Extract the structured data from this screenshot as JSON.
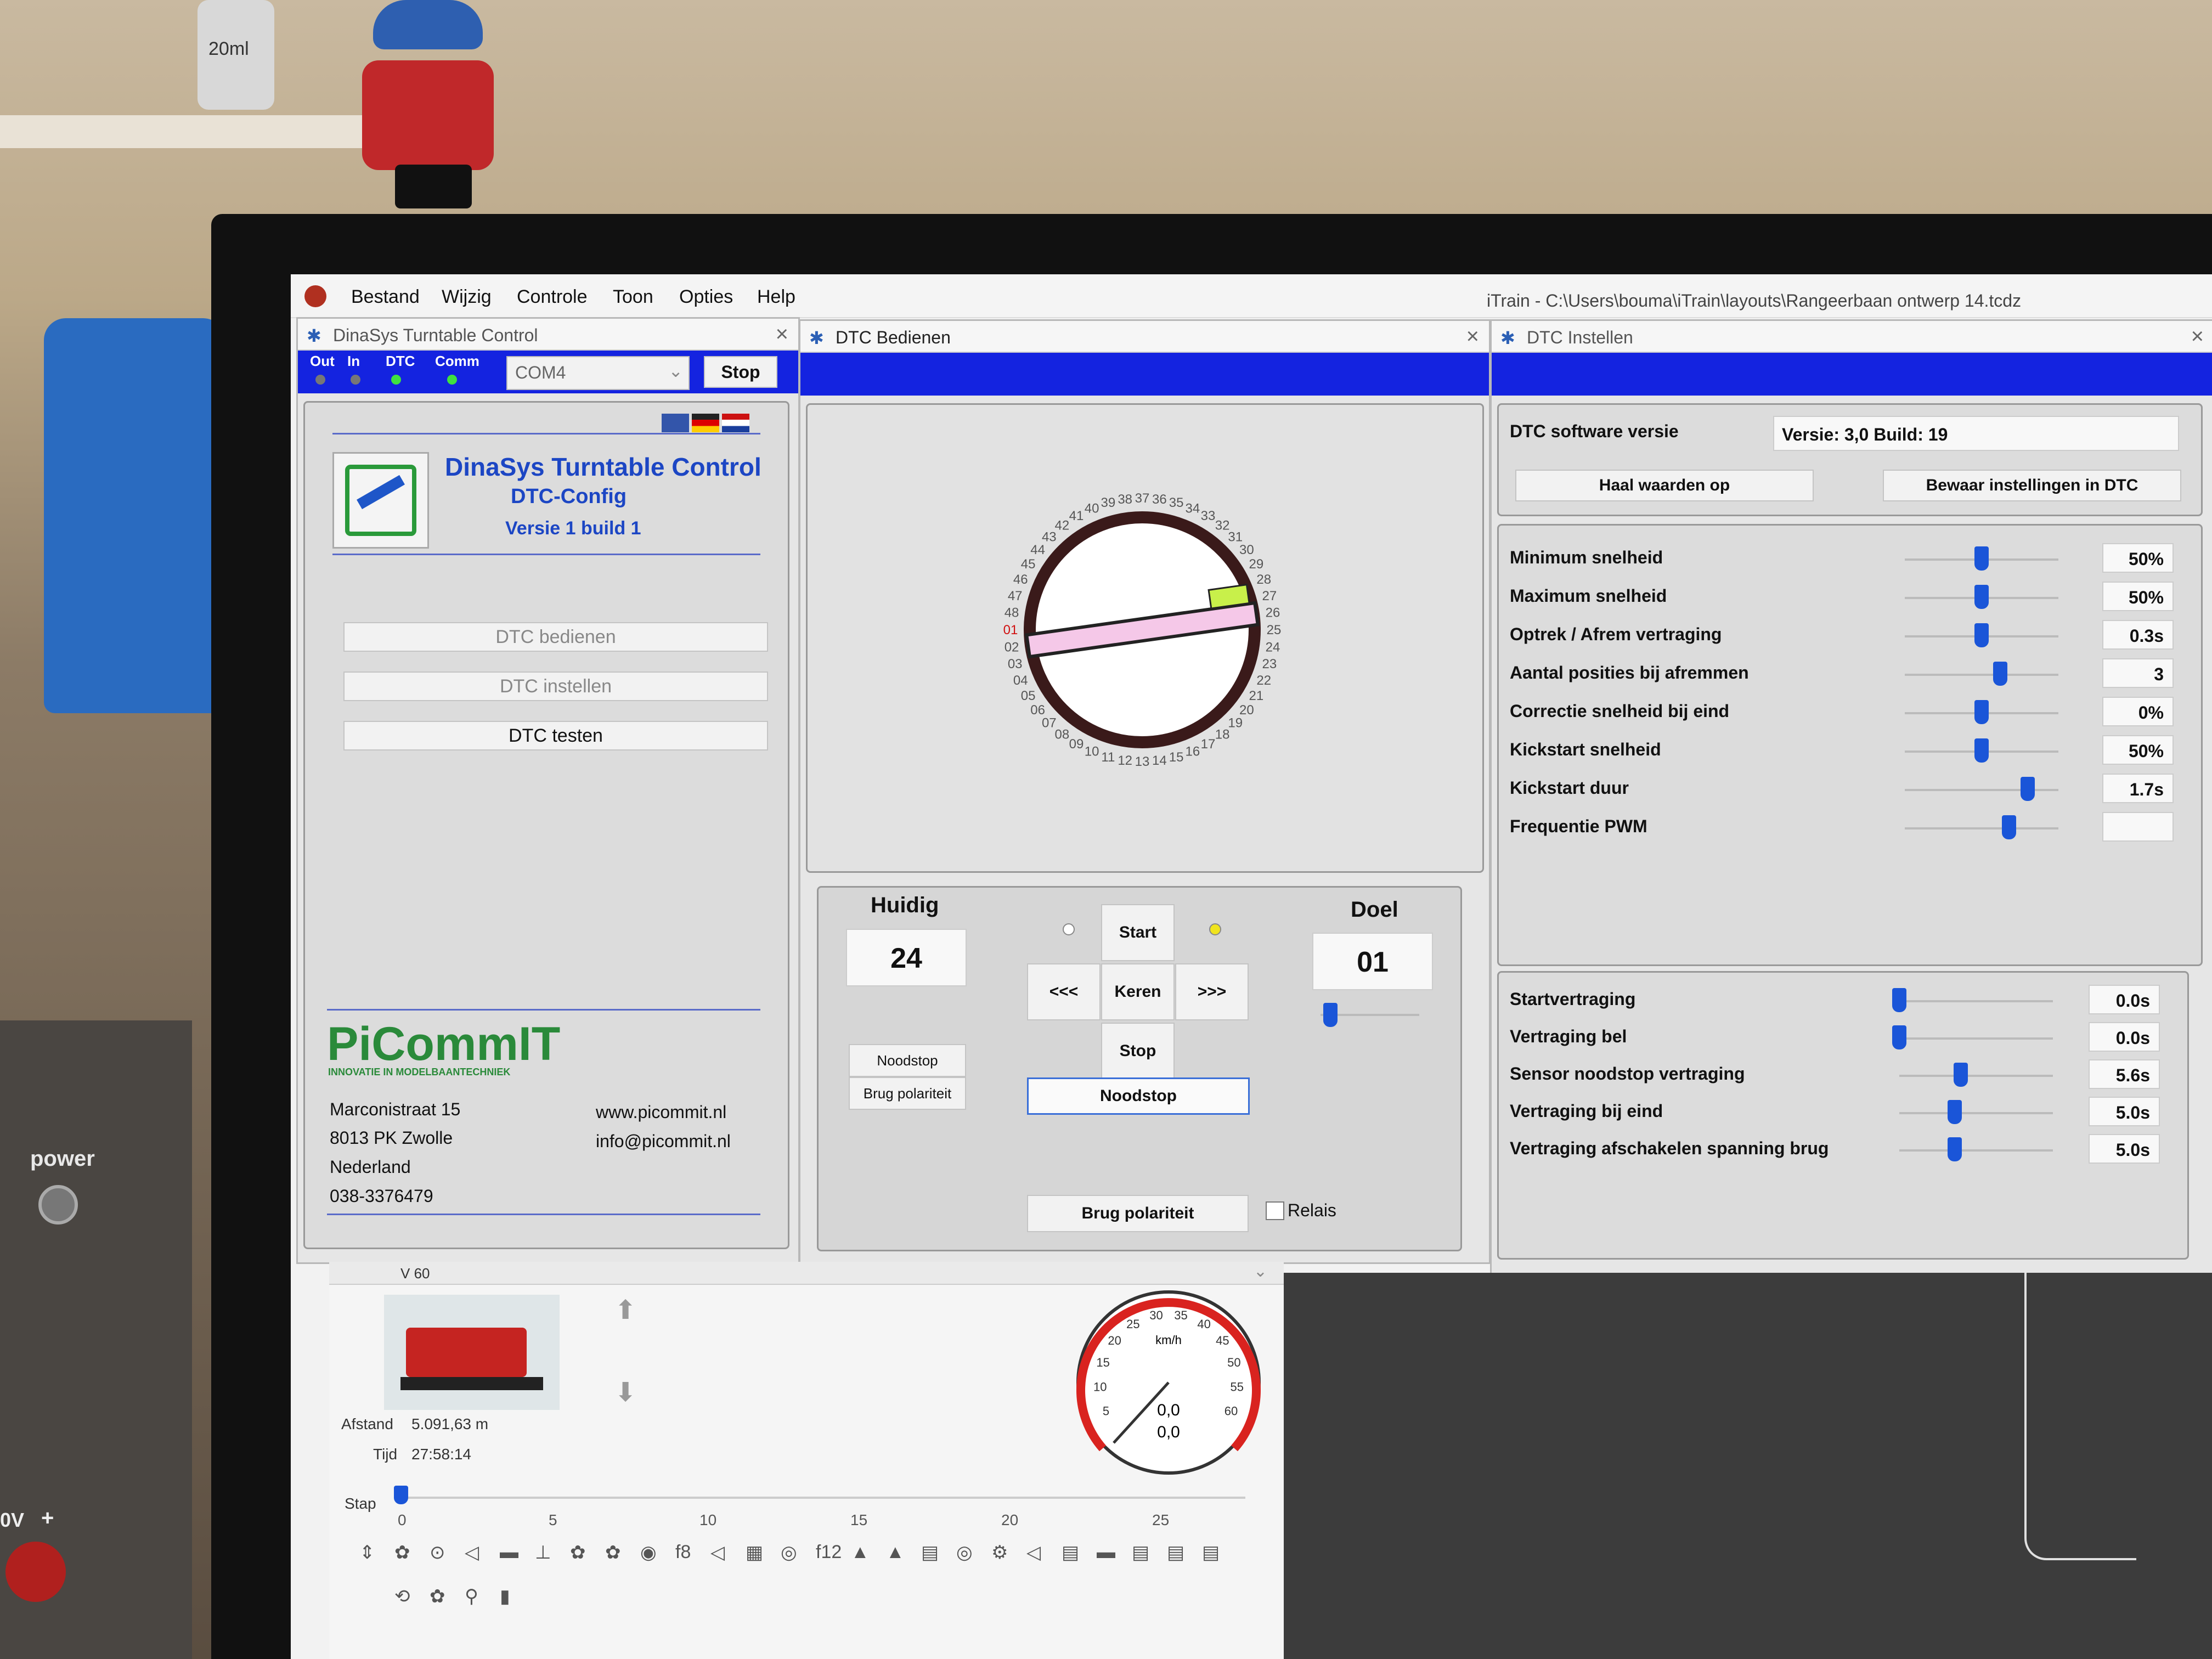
{
  "menubar": {
    "items": [
      "Bestand",
      "Wijzig",
      "Controle",
      "Toon",
      "Opties",
      "Help"
    ],
    "title": "iTrain - C:\\Users\\bouma\\iTrain\\layouts\\Rangeerbaan  ontwerp 14.tcdz"
  },
  "dinasys": {
    "title": "DinaSys Turntable Control",
    "leds": [
      "Out",
      "In",
      "DTC",
      "Comm"
    ],
    "port": "COM4",
    "stop": "Stop",
    "heading": "DinaSys Turntable Control",
    "subheading": "DTC-Config",
    "version": "Versie 1 build 1",
    "buttons": [
      "DTC bedienen",
      "DTC instellen",
      "DTC testen"
    ],
    "logo": "PiCommIT",
    "logo_tag": "INNOVATIE IN MODELBAANTECHNIEK",
    "address": [
      "Marconistraat 15",
      "8013 PK Zwolle",
      "Nederland",
      "038-3376479"
    ],
    "web": "www.picommit.nl",
    "email": "info@picommit.nl"
  },
  "bedienen": {
    "title": "DTC Bedienen",
    "huidig_label": "Huidig",
    "huidig_value": "24",
    "doel_label": "Doel",
    "doel_value": "01",
    "start": "Start",
    "left": "<<<",
    "keren": "Keren",
    "right": ">>>",
    "stop": "Stop",
    "noodstop_small": "Noodstop",
    "brug_small": "Brug polariteit",
    "noodstop": "Noodstop",
    "brug": "Brug polariteit",
    "relais": "Relais",
    "positions": [
      "01",
      "02",
      "03",
      "04",
      "05",
      "06",
      "07",
      "08",
      "09",
      "10",
      "11",
      "12",
      "13",
      "14",
      "15",
      "16",
      "17",
      "18",
      "19",
      "20",
      "21",
      "22",
      "23",
      "24",
      "25",
      "26",
      "27",
      "28",
      "29",
      "30",
      "31",
      "32",
      "33",
      "34",
      "35",
      "36",
      "37",
      "38",
      "39",
      "40",
      "41",
      "42",
      "43",
      "44",
      "45",
      "46",
      "47",
      "48"
    ]
  },
  "instellen": {
    "title": "DTC Instellen",
    "software_label": "DTC software versie",
    "software_value": "Versie: 3,0 Build: 19",
    "haal": "Haal waarden op",
    "bewaar": "Bewaar instellingen in DTC",
    "settings": [
      {
        "label": "Minimum snelheid",
        "value": "50%",
        "level": 0.5
      },
      {
        "label": "Maximum snelheid",
        "value": "50%",
        "level": 0.5
      },
      {
        "label": "Optrek / Afrem vertraging",
        "value": "0.3s",
        "level": 0.5
      },
      {
        "label": "Aantal posities bij afremmen",
        "value": "3",
        "level": 0.62
      },
      {
        "label": "Correctie snelheid bij eind",
        "value": "0%",
        "level": 0.5
      },
      {
        "label": "Kickstart snelheid",
        "value": "50%",
        "level": 0.5
      },
      {
        "label": "Kickstart duur",
        "value": "1.7s",
        "level": 0.8
      },
      {
        "label": "Frequentie PWM",
        "value": "",
        "level": 0.68
      }
    ],
    "delays": [
      {
        "label": "Startvertraging",
        "value": "0.0s",
        "level": 0.0
      },
      {
        "label": "Vertraging bel",
        "value": "0.0s",
        "level": 0.0
      },
      {
        "label": "Sensor noodstop vertraging",
        "value": "5.6s",
        "level": 0.4
      },
      {
        "label": "Vertraging bij eind",
        "value": "5.0s",
        "level": 0.36
      },
      {
        "label": "Vertraging afschakelen spanning brug",
        "value": "5.0s",
        "level": 0.36
      }
    ]
  },
  "loco": {
    "name": "V 60",
    "afstand_label": "Afstand",
    "afstand": "5.091,63 m",
    "tijd_label": "Tijd",
    "tijd": "27:58:14",
    "stap_label": "Stap",
    "stap_ticks": [
      "0",
      "5",
      "10",
      "15",
      "20",
      "25"
    ],
    "speed_unit": "km/h",
    "speed1": "0,0",
    "speed2": "0,0",
    "speed_ticks": [
      "5",
      "10",
      "15",
      "20",
      "25",
      "30",
      "35",
      "40",
      "45",
      "50",
      "55",
      "60"
    ],
    "fkeys": [
      "f8",
      "f12"
    ]
  },
  "room": {
    "bottle_label": "20ml",
    "power_label": "power",
    "volt_label": "0V",
    "plus": "+"
  }
}
